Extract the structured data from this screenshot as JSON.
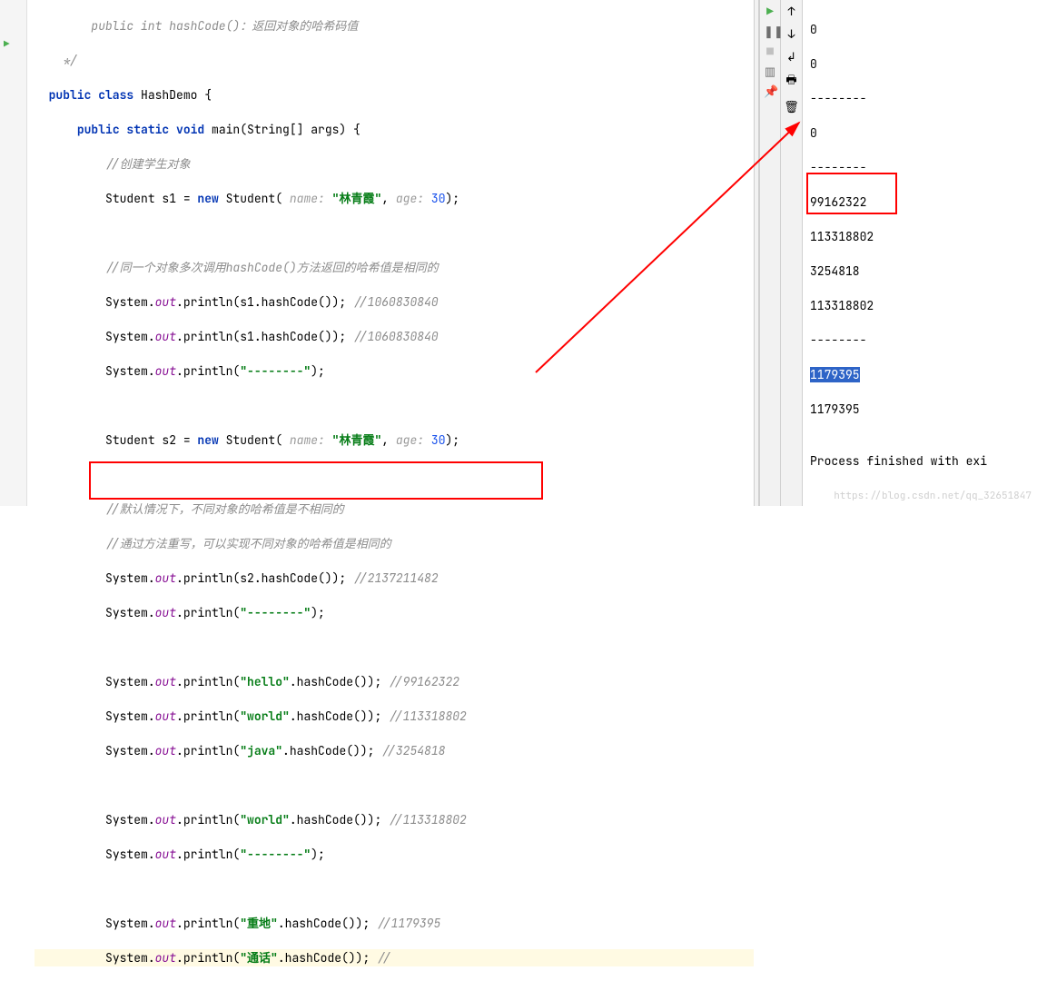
{
  "code": {
    "comment_top": "public int hashCode()：返回对象的哈希码值",
    "comment_end": "*/",
    "class_kw": "public class",
    "class_name": "HashDemo {",
    "main_sig1": "public static void",
    "main_sig2": "main(String[] args) {",
    "c_create": "//创建学生对象",
    "s1_a": "Student s1 = ",
    "s1_new": "new",
    "s1_b": " Student( ",
    "s1_hint1": "name: ",
    "s1_name": "\"林青霞\"",
    "s1_c": ", ",
    "s1_hint2": "age: ",
    "s1_age": "30",
    "s1_d": ");",
    "c_same": "//同一个对象多次调用hashCode()方法返回的哈希值是相同的",
    "p_out": "System.",
    "p_field": "out",
    "p_s1a": ".println(s1.hashCode()); ",
    "c_hash1": "//1060830840",
    "p_dash": ".println(",
    "dash_str": "\"--------\"",
    "dash_end": ");",
    "s2_a": "Student s2 = ",
    "c_diff1": "//默认情况下，不同对象的哈希值是不相同的",
    "c_diff2": "//通过方法重写，可以实现不同对象的哈希值是相同的",
    "p_s2": ".println(s2.hashCode()); ",
    "c_hash2": "//2137211482",
    "hello": "\"hello\"",
    "world": "\"world\"",
    "java": "\"java\"",
    "zhongdi": "\"重地\"",
    "tonghua": "\"通话\"",
    "hc_call": ".hashCode()); ",
    "c_h_hello": "//99162322",
    "c_h_world": "//113318802",
    "c_h_java": "//3254818",
    "c_h_zhongdi": "//1179395",
    "c_h_tonghua": "//"
  },
  "output": {
    "lines": [
      "0",
      "0",
      "--------",
      "0",
      "--------",
      "99162322",
      "113318802",
      "3254818",
      "113318802",
      "--------",
      "1179395",
      "1179395",
      "",
      "Process finished with exi"
    ]
  },
  "watermark": "https://blog.csdn.net/qq_32651847"
}
